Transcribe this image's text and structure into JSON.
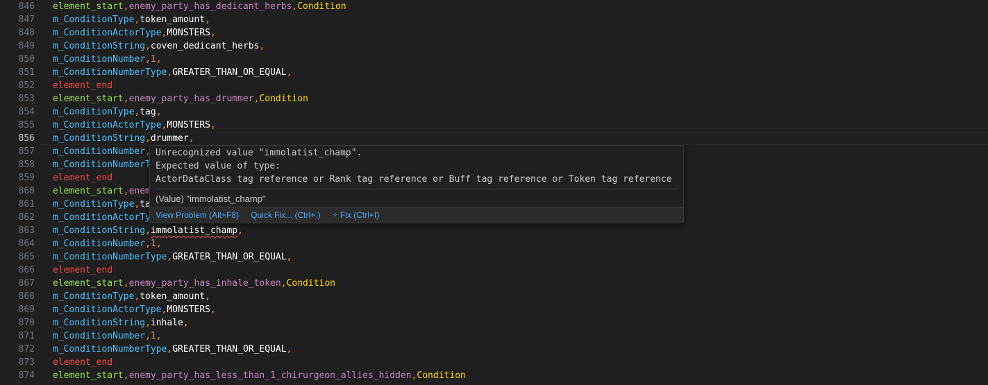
{
  "editor": {
    "current_line": "856",
    "lines": [
      {
        "n": "846",
        "parts": [
          {
            "k": "start",
            "t": "element_start"
          },
          {
            "k": "comma",
            "t": ","
          },
          {
            "k": "ident",
            "t": "enemy_party_has_dedicant_herbs"
          },
          {
            "k": "comma",
            "t": ","
          },
          {
            "k": "cond",
            "t": "Condition"
          }
        ]
      },
      {
        "n": "847",
        "parts": [
          {
            "k": "key",
            "t": "m_ConditionType"
          },
          {
            "k": "comma",
            "t": ","
          },
          {
            "k": "text",
            "t": "token_amount"
          },
          {
            "k": "comma",
            "t": ","
          }
        ]
      },
      {
        "n": "848",
        "parts": [
          {
            "k": "key",
            "t": "m_ConditionActorType"
          },
          {
            "k": "comma",
            "t": ","
          },
          {
            "k": "text",
            "t": "MONSTERS"
          },
          {
            "k": "comma",
            "t": ","
          }
        ]
      },
      {
        "n": "849",
        "parts": [
          {
            "k": "key",
            "t": "m_ConditionString"
          },
          {
            "k": "comma",
            "t": ","
          },
          {
            "k": "text",
            "t": "coven_dedicant_herbs"
          },
          {
            "k": "comma",
            "t": ","
          }
        ]
      },
      {
        "n": "850",
        "parts": [
          {
            "k": "key",
            "t": "m_ConditionNumber"
          },
          {
            "k": "comma",
            "t": ","
          },
          {
            "k": "num",
            "t": "1"
          },
          {
            "k": "comma",
            "t": ","
          }
        ]
      },
      {
        "n": "851",
        "parts": [
          {
            "k": "key",
            "t": "m_ConditionNumberType"
          },
          {
            "k": "comma",
            "t": ","
          },
          {
            "k": "text",
            "t": "GREATER_THAN_OR_EQUAL"
          },
          {
            "k": "comma",
            "t": ","
          }
        ]
      },
      {
        "n": "852",
        "parts": [
          {
            "k": "end",
            "t": "element_end"
          }
        ]
      },
      {
        "n": "853",
        "parts": [
          {
            "k": "start",
            "t": "element_start"
          },
          {
            "k": "comma",
            "t": ","
          },
          {
            "k": "ident",
            "t": "enemy_party_has_drummer"
          },
          {
            "k": "comma",
            "t": ","
          },
          {
            "k": "cond",
            "t": "Condition"
          }
        ]
      },
      {
        "n": "854",
        "parts": [
          {
            "k": "key",
            "t": "m_ConditionType"
          },
          {
            "k": "comma",
            "t": ","
          },
          {
            "k": "text",
            "t": "tag"
          },
          {
            "k": "comma",
            "t": ","
          }
        ]
      },
      {
        "n": "855",
        "parts": [
          {
            "k": "key",
            "t": "m_ConditionActorType"
          },
          {
            "k": "comma",
            "t": ","
          },
          {
            "k": "text",
            "t": "MONSTERS"
          },
          {
            "k": "comma",
            "t": ","
          }
        ]
      },
      {
        "n": "856",
        "parts": [
          {
            "k": "key",
            "t": "m_ConditionString"
          },
          {
            "k": "comma",
            "t": ","
          },
          {
            "k": "text",
            "t": "drummer"
          },
          {
            "k": "comma",
            "t": ","
          }
        ]
      },
      {
        "n": "857",
        "parts": [
          {
            "k": "key",
            "t": "m_ConditionNumber"
          },
          {
            "k": "comma",
            "t": ","
          }
        ]
      },
      {
        "n": "858",
        "parts": [
          {
            "k": "key",
            "t": "m_ConditionNumberT"
          }
        ]
      },
      {
        "n": "859",
        "parts": [
          {
            "k": "end",
            "t": "element_end"
          }
        ]
      },
      {
        "n": "860",
        "parts": [
          {
            "k": "start",
            "t": "element_start"
          },
          {
            "k": "comma",
            "t": ","
          },
          {
            "k": "ident",
            "t": "enem"
          }
        ]
      },
      {
        "n": "861",
        "parts": [
          {
            "k": "key",
            "t": "m_ConditionType"
          },
          {
            "k": "comma",
            "t": ","
          },
          {
            "k": "text",
            "t": "ta"
          }
        ]
      },
      {
        "n": "862",
        "parts": [
          {
            "k": "key",
            "t": "m_ConditionActorTy"
          }
        ]
      },
      {
        "n": "863",
        "parts": [
          {
            "k": "key",
            "t": "m_ConditionString"
          },
          {
            "k": "comma",
            "t": ","
          },
          {
            "k": "text",
            "t": "immolatist_champ",
            "err": true
          },
          {
            "k": "comma",
            "t": ","
          }
        ]
      },
      {
        "n": "864",
        "parts": [
          {
            "k": "key",
            "t": "m_ConditionNumber"
          },
          {
            "k": "comma",
            "t": ","
          },
          {
            "k": "num",
            "t": "1"
          },
          {
            "k": "comma",
            "t": ","
          }
        ]
      },
      {
        "n": "865",
        "parts": [
          {
            "k": "key",
            "t": "m_ConditionNumberType"
          },
          {
            "k": "comma",
            "t": ","
          },
          {
            "k": "text",
            "t": "GREATER_THAN_OR_EQUAL"
          },
          {
            "k": "comma",
            "t": ","
          }
        ]
      },
      {
        "n": "866",
        "parts": [
          {
            "k": "end",
            "t": "element_end"
          }
        ]
      },
      {
        "n": "867",
        "parts": [
          {
            "k": "start",
            "t": "element_start"
          },
          {
            "k": "comma",
            "t": ","
          },
          {
            "k": "ident",
            "t": "enemy_party_has_inhale_token"
          },
          {
            "k": "comma",
            "t": ","
          },
          {
            "k": "cond",
            "t": "Condition"
          }
        ]
      },
      {
        "n": "868",
        "parts": [
          {
            "k": "key",
            "t": "m_ConditionType"
          },
          {
            "k": "comma",
            "t": ","
          },
          {
            "k": "text",
            "t": "token_amount"
          },
          {
            "k": "comma",
            "t": ","
          }
        ]
      },
      {
        "n": "869",
        "parts": [
          {
            "k": "key",
            "t": "m_ConditionActorType"
          },
          {
            "k": "comma",
            "t": ","
          },
          {
            "k": "text",
            "t": "MONSTERS"
          },
          {
            "k": "comma",
            "t": ","
          }
        ]
      },
      {
        "n": "870",
        "parts": [
          {
            "k": "key",
            "t": "m_ConditionString"
          },
          {
            "k": "comma",
            "t": ","
          },
          {
            "k": "text",
            "t": "inhale"
          },
          {
            "k": "comma",
            "t": ","
          }
        ]
      },
      {
        "n": "871",
        "parts": [
          {
            "k": "key",
            "t": "m_ConditionNumber"
          },
          {
            "k": "comma",
            "t": ","
          },
          {
            "k": "num",
            "t": "1"
          },
          {
            "k": "comma",
            "t": ","
          }
        ]
      },
      {
        "n": "872",
        "parts": [
          {
            "k": "key",
            "t": "m_ConditionNumberType"
          },
          {
            "k": "comma",
            "t": ","
          },
          {
            "k": "text",
            "t": "GREATER_THAN_OR_EQUAL"
          },
          {
            "k": "comma",
            "t": ","
          }
        ]
      },
      {
        "n": "873",
        "parts": [
          {
            "k": "end",
            "t": "element_end"
          }
        ]
      },
      {
        "n": "874",
        "parts": [
          {
            "k": "start",
            "t": "element_start"
          },
          {
            "k": "comma",
            "t": ","
          },
          {
            "k": "ident",
            "t": "enemy_party_has_less_than_1_chirurgeon_allies_hidden"
          },
          {
            "k": "comma",
            "t": ","
          },
          {
            "k": "cond",
            "t": "Condition"
          }
        ]
      }
    ]
  },
  "hover": {
    "message_line1": "Unrecognized value \"immolatist_champ\".",
    "message_line2": "Expected value of type:",
    "message_line3": "ActorDataClass tag reference or Rank tag reference or Buff tag reference or Token tag reference",
    "value_line": "(Value) \"immolatist_champ\"",
    "actions": {
      "view_problem": "View Problem (Alt+F8)",
      "quick_fix": "Quick Fix... (Ctrl+.)",
      "fix": "Fix (Ctrl+I)"
    },
    "sparkle_icon": "sparkle-icon"
  },
  "colors": {
    "background": "#1f1f1f",
    "key": "#4fc1ff",
    "element_start": "#9be05a",
    "element_end": "#f44747",
    "identifier": "#c586c0",
    "condition": "#ffd700",
    "comma": "#ff8c28",
    "number": "#ce9178",
    "link": "#4daafc"
  }
}
